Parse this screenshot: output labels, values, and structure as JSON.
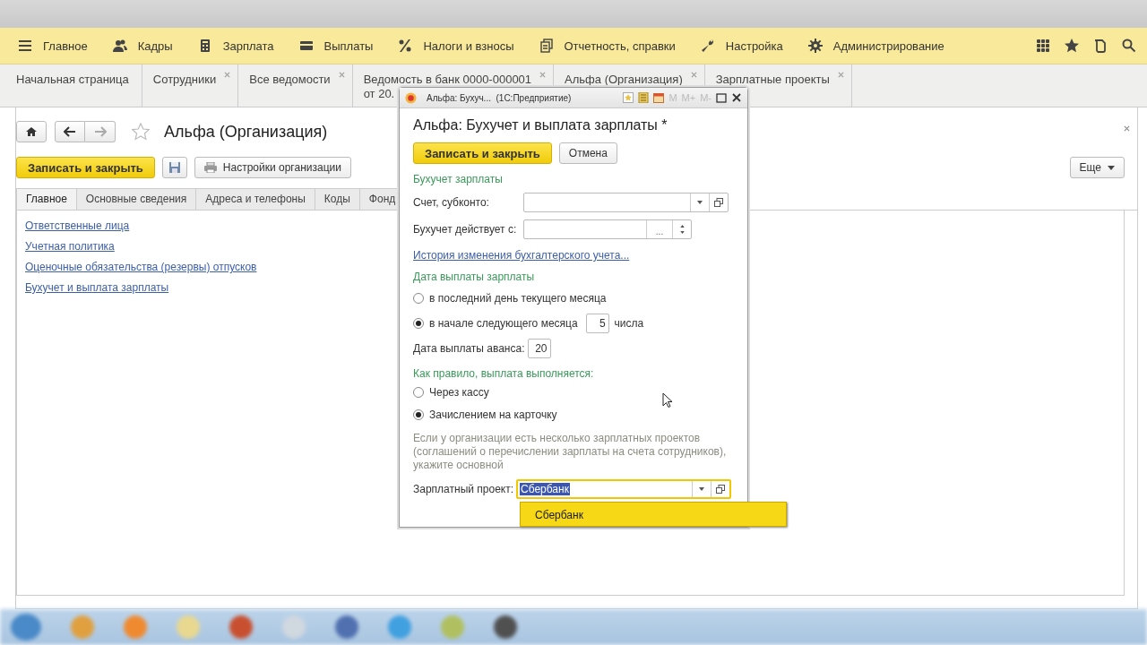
{
  "menu": [
    {
      "label": "Главное",
      "kind": "lines"
    },
    {
      "label": "Кадры",
      "kind": "people"
    },
    {
      "label": "Зарплата",
      "kind": "calc"
    },
    {
      "label": "Выплаты",
      "kind": "wallet"
    },
    {
      "label": "Налоги и взносы",
      "kind": "percent"
    },
    {
      "label": "Отчетность, справки",
      "kind": "docs"
    },
    {
      "label": "Настройка",
      "kind": "wrench"
    },
    {
      "label": "Администрирование",
      "kind": "gear"
    }
  ],
  "open_tabs": [
    {
      "label": "Начальная страница",
      "closable": false
    },
    {
      "label": "Сотрудники",
      "closable": true
    },
    {
      "label": "Все ведомости",
      "closable": true
    },
    {
      "label": "Ведомость в банк 0000-000001",
      "label_2": "от 20.",
      "closable": true
    },
    {
      "label": "Альфа (Организация)",
      "closable": true
    },
    {
      "label": "Зарплатные проекты",
      "closable": true
    }
  ],
  "form": {
    "title": "Альфа (Организация)",
    "save_button": "Записать и закрыть",
    "settings_button": "Настройки организации",
    "more_button": "Еще",
    "tabs": [
      {
        "label": "Главное",
        "selected": true
      },
      {
        "label": "Основные сведения",
        "selected": false
      },
      {
        "label": "Адреса и телефоны",
        "selected": false
      },
      {
        "label": "Коды",
        "selected": false
      },
      {
        "label": "Фонд",
        "selected": false
      }
    ],
    "links": [
      "Ответственные лица",
      "Учетная политика",
      "Оценочные обязательства (резервы) отпусков",
      "Бухучет и выплата зарплаты"
    ]
  },
  "dialog": {
    "window_title": "Альфа: Бухуч...  (1С:Предприятие)",
    "memory_buttons": [
      "M",
      "M+",
      "M-"
    ],
    "title": "Альфа: Бухучет и выплата зарплаты *",
    "save_button": "Записать и закрыть",
    "cancel_button": "Отмена",
    "accounting": {
      "heading": "Бухучет зарплаты",
      "account_label": "Счет, субконто:",
      "date_label": "Бухучет действует с:",
      "date_button": "...",
      "history_link": "История изменения бухгалтерского учета..."
    },
    "pay_date": {
      "heading": "Дата выплаты зарплаты",
      "options": [
        {
          "label": "в последний день текущего месяца",
          "selected": false
        },
        {
          "label": "в начале следующего месяца",
          "selected": true,
          "day": "5",
          "suffix": "числа"
        }
      ],
      "advance_label": "Дата выплаты аванса:",
      "advance_day": "20"
    },
    "payment": {
      "heading": "Как правило, выплата выполняется:",
      "options": [
        {
          "label": "Через кассу",
          "selected": false
        },
        {
          "label": "Зачислением на карточку",
          "selected": true
        }
      ],
      "note": "Если у организации есть несколько зарплатных проектов (соглашений о перечислении зарплаты на счета сотрудников), укажите основной",
      "project_label": "Зарплатный проект:",
      "project_value": "Сбербанк",
      "suggestions": [
        {
          "label": "Сбербанк",
          "selected": true
        }
      ]
    }
  }
}
